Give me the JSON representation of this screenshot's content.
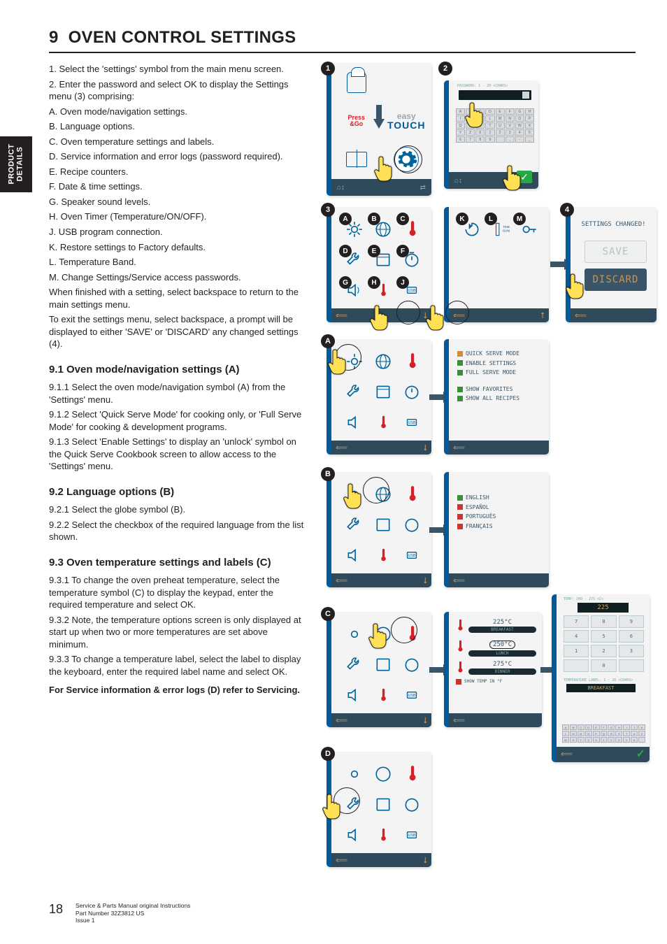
{
  "section": {
    "number": "9",
    "title": "OVEN CONTROL SETTINGS"
  },
  "sideTab": {
    "line1": "PRODUCT",
    "line2": "DETAILS"
  },
  "intro": [
    "1. Select the 'settings' symbol from the main menu screen.",
    "2. Enter the password and select OK to display the Settings menu (3) comprising:",
    "A. Oven mode/navigation settings.",
    "B. Language options.",
    "C. Oven temperature settings and labels.",
    "D. Service information and error logs (password required).",
    "E. Recipe counters.",
    "F. Date & time settings.",
    "G. Speaker sound levels.",
    "H. Oven Timer (Temperature/ON/OFF).",
    "J. USB program connection.",
    "K. Restore settings to Factory defaults.",
    "L. Temperature Band.",
    "M. Change Settings/Service access passwords.",
    "When finished with a setting, select backspace to return to the main settings menu.",
    "To exit the settings menu, select backspace, a prompt will be displayed to either 'SAVE' or 'DISCARD' any changed settings (4)."
  ],
  "s91": {
    "h": "9.1  Oven mode/navigation settings (A)",
    "p": [
      "9.1.1   Select the oven mode/navigation symbol (A) from the 'Settings' menu.",
      "9.1.2   Select 'Quick Serve Mode' for cooking only, or 'Full Serve Mode' for cooking & development programs.",
      "9.1.3   Select 'Enable Settings' to display an 'unlock' symbol on the Quick Serve Cookbook screen to allow access to the 'Settings' menu."
    ]
  },
  "s92": {
    "h": "9.2  Language options (B)",
    "p": [
      "9.2.1   Select the globe symbol (B).",
      "9.2.2   Select the checkbox of the required language from the list shown."
    ]
  },
  "s93": {
    "h": "9.3  Oven temperature settings and labels (C)",
    "p": [
      "9.3.1   To change the oven preheat temperature, select the temperature symbol (C) to display the keypad, enter the required temperature and select OK.",
      "9.3.2   Note, the temperature options screen is only displayed at start up when two or more temperatures are set above minimum.",
      "9.3.3   To change a temperature label, select the label to display the keyboard, enter the required label name and select OK."
    ],
    "svc": "For Service information & error logs (D) refer to Servicing."
  },
  "footer": {
    "page": "18",
    "l1": "Service & Parts Manual original Instructions",
    "l2": "Part Number 32Z3812 US",
    "l3": "Issue 1"
  },
  "fig": {
    "badges": {
      "n1": "1",
      "n2": "2",
      "n3": "3",
      "n4": "4",
      "A": "A",
      "B": "B",
      "C": "C",
      "D": "D",
      "E": "E",
      "F": "F",
      "G": "G",
      "H": "H",
      "J": "J",
      "K": "K",
      "L": "L",
      "M": "M"
    },
    "touch": {
      "press": "Press",
      "go": "&Go",
      "easy": "easy",
      "touch": "TOUCH"
    },
    "pwd": {
      "label": "PASSWORD: 1 - 20 <CHARS>"
    },
    "saved": {
      "title": "SETTINGS CHANGED!",
      "save": "SAVE",
      "discard": "DISCARD"
    },
    "modeOpts": {
      "o1": "QUICK SERVE MODE",
      "o2": "ENABLE SETTINGS",
      "o3": "FULL SERVE MODE",
      "o4": "SHOW FAVORITES",
      "o5": "SHOW ALL RECIPES"
    },
    "langs": {
      "l1": "ENGLISH",
      "l2": "ESPAÑOL",
      "l3": "PORTUGUÊS",
      "l4": "FRANÇAIS"
    },
    "temps": {
      "t1v": "225°C",
      "t1n": "BREAKFAST",
      "t2v": "250°C",
      "t2n": "LUNCH",
      "t3v": "275°C",
      "t3n": "DINNER",
      "show": "SHOW TEMP IN °F",
      "range": "TEMP: 200 - 275 <C>",
      "entry": "225",
      "lblhdr": "TEMPERATURE LABEL: 1 - 20 <CHARS>",
      "lblval": "BREAKFAST"
    }
  }
}
